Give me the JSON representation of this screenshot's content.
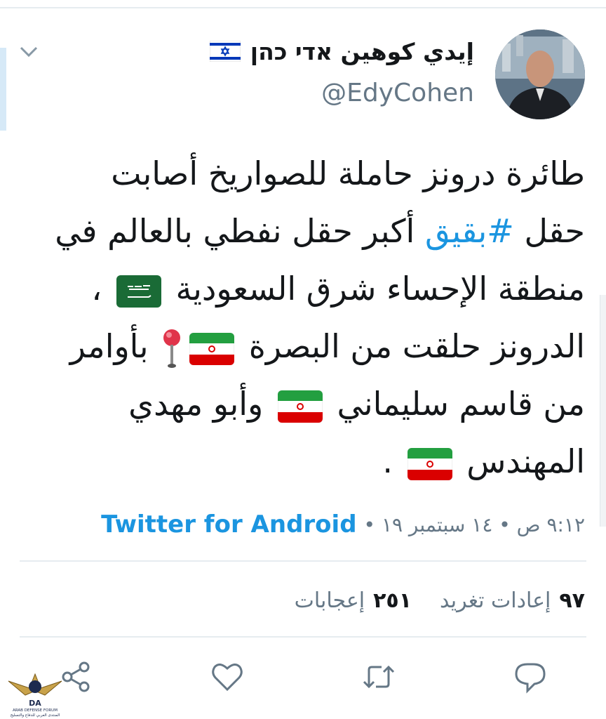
{
  "tweet_header": {
    "display_name": "إيدي كوهين אדי כהן",
    "handle": "@EdyCohen"
  },
  "tweet_body": {
    "line1": "طائرة درونز حاملة للصواريخ أصابت",
    "line2_before": "حقل ",
    "hashtag": "#بقيق",
    "line2_after": " أكبر حقل نفطي بالعالم في",
    "line3": "منطقة الإحساء شرق السعودية",
    "line3_end": " ،",
    "line4_start": "الدرونز حلقت من البصرة",
    "line4_end": "بأوامر",
    "line5_start": "من قاسم سليماني",
    "line5_end": "وأبو مهدي",
    "line6_start": "المهندس",
    "line6_end": " ."
  },
  "meta": {
    "timestamp": "٩:١٢ ص • ١٤ سبتمبر ١٩ •",
    "source": "Twitter for Android"
  },
  "stats": {
    "retweets_count": "٩٧",
    "retweets_label": "إعادات تغريد",
    "likes_count": "٢٥١",
    "likes_label": "إعجابات"
  },
  "watermark": {
    "abbr": "DA",
    "name": "ARAB DEFENSE FORUM",
    "tagline": "المنتدى العربي للدفاع والتسليح"
  },
  "colors": {
    "link": "#1b95e0",
    "secondary": "#657786",
    "text": "#14171a",
    "saudi_green": "#1a6b36",
    "iran_green": "#239f40",
    "iran_red": "#da0000",
    "israel_blue": "#0038b8"
  },
  "icons": [
    "chevron-down-icon",
    "share-icon",
    "like-icon",
    "retweet-icon",
    "reply-icon",
    "round-pushpin-icon"
  ]
}
